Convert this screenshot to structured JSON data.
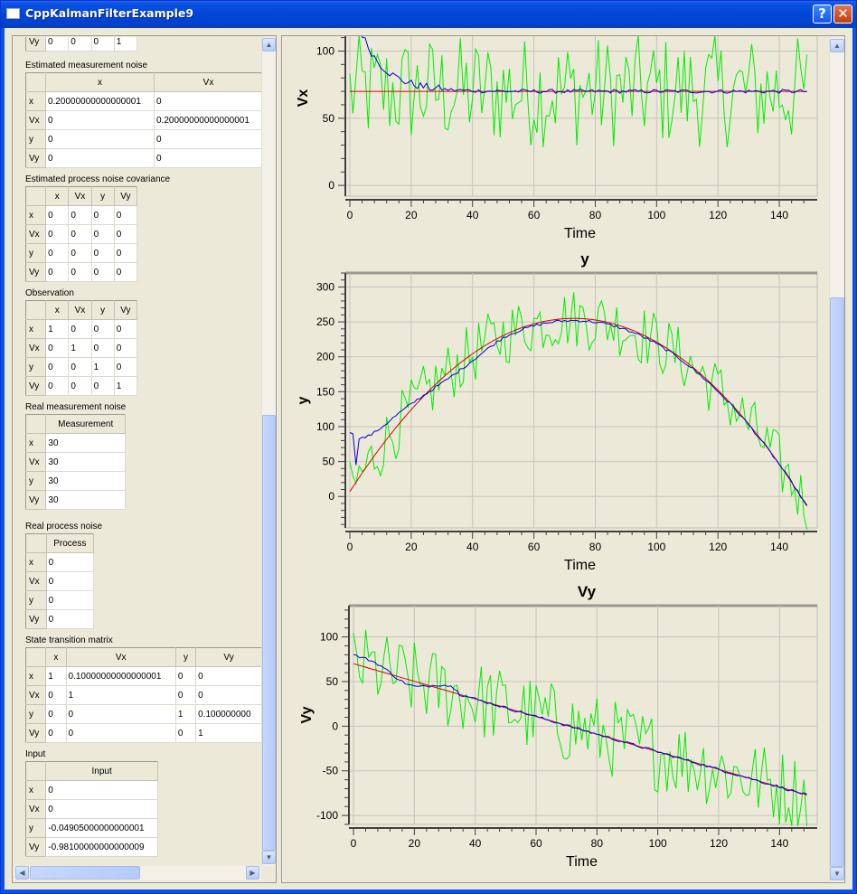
{
  "window": {
    "title": "CppKalmanFilterExample9",
    "help_label": "?",
    "close_label": "✕"
  },
  "left_panel": {
    "partial_row": {
      "header": "Vy",
      "cells": [
        "0",
        "0",
        "0",
        "1"
      ]
    },
    "estimated_measurement_noise": {
      "title": "Estimated measurement noise",
      "columns": [
        "x",
        "Vx"
      ],
      "rows": [
        {
          "header": "x",
          "cells": [
            "0.20000000000000001",
            "0"
          ]
        },
        {
          "header": "Vx",
          "cells": [
            "0",
            "0.20000000000000001"
          ]
        },
        {
          "header": "y",
          "cells": [
            "0",
            "0"
          ]
        },
        {
          "header": "Vy",
          "cells": [
            "0",
            "0"
          ]
        }
      ]
    },
    "estimated_process_noise": {
      "title": "Estimated process noise covariance",
      "columns": [
        "x",
        "Vx",
        "y",
        "Vy"
      ],
      "rows": [
        {
          "header": "x",
          "cells": [
            "0",
            "0",
            "0",
            "0"
          ]
        },
        {
          "header": "Vx",
          "cells": [
            "0",
            "0",
            "0",
            "0"
          ]
        },
        {
          "header": "y",
          "cells": [
            "0",
            "0",
            "0",
            "0"
          ]
        },
        {
          "header": "Vy",
          "cells": [
            "0",
            "0",
            "0",
            "0"
          ]
        }
      ]
    },
    "observation": {
      "title": "Observation",
      "columns": [
        "x",
        "Vx",
        "y",
        "Vy"
      ],
      "rows": [
        {
          "header": "x",
          "cells": [
            "1",
            "0",
            "0",
            "0"
          ]
        },
        {
          "header": "Vx",
          "cells": [
            "0",
            "1",
            "0",
            "0"
          ]
        },
        {
          "header": "y",
          "cells": [
            "0",
            "0",
            "1",
            "0"
          ]
        },
        {
          "header": "Vy",
          "cells": [
            "0",
            "0",
            "0",
            "1"
          ]
        }
      ]
    },
    "real_measurement_noise": {
      "title": "Real measurement noise",
      "columns": [
        "Measurement"
      ],
      "rows": [
        {
          "header": "x",
          "cells": [
            "30"
          ]
        },
        {
          "header": "Vx",
          "cells": [
            "30"
          ]
        },
        {
          "header": "y",
          "cells": [
            "30"
          ]
        },
        {
          "header": "Vy",
          "cells": [
            "30"
          ]
        }
      ]
    },
    "real_process_noise": {
      "title": "Real process noise",
      "columns": [
        "Process"
      ],
      "rows": [
        {
          "header": "x",
          "cells": [
            "0"
          ]
        },
        {
          "header": "Vx",
          "cells": [
            "0"
          ]
        },
        {
          "header": "y",
          "cells": [
            "0"
          ]
        },
        {
          "header": "Vy",
          "cells": [
            "0"
          ]
        }
      ]
    },
    "state_transition": {
      "title": "State transition matrix",
      "columns": [
        "x",
        "Vx",
        "y",
        "Vy"
      ],
      "rows": [
        {
          "header": "x",
          "cells": [
            "1",
            "0.10000000000000001",
            "0",
            "0"
          ]
        },
        {
          "header": "Vx",
          "cells": [
            "0",
            "1",
            "0",
            "0"
          ]
        },
        {
          "header": "y",
          "cells": [
            "0",
            "0",
            "1",
            "0.100000000"
          ]
        },
        {
          "header": "Vy",
          "cells": [
            "0",
            "0",
            "0",
            "1"
          ]
        }
      ]
    },
    "input": {
      "title": "Input",
      "columns": [
        "Input"
      ],
      "rows": [
        {
          "header": "x",
          "cells": [
            "0"
          ]
        },
        {
          "header": "Vx",
          "cells": [
            "0"
          ]
        },
        {
          "header": "y",
          "cells": [
            "-0.04905000000000001"
          ]
        },
        {
          "header": "Vy",
          "cells": [
            "-0.98100000000000009"
          ]
        }
      ]
    }
  },
  "colors": {
    "measured": "#00ee00",
    "estimated": "#0000dd",
    "real": "#dd0000",
    "plot_bg": "#ece9d8",
    "grid": "#c6c4bd"
  },
  "chart_data": [
    {
      "type": "line",
      "title": "",
      "xlabel": "Time",
      "ylabel": "Vx",
      "xlim": [
        0,
        150
      ],
      "ylim": [
        -8,
        138
      ],
      "xticks": [
        0,
        20,
        40,
        60,
        80,
        100,
        120,
        140
      ],
      "yticks": [
        0,
        50,
        100
      ],
      "series": [
        {
          "key": "real",
          "values_type": "constant",
          "value": 70
        },
        {
          "key": "estimated",
          "values_type": "decay",
          "start": 140,
          "end": 70,
          "tau": 8
        },
        {
          "key": "measured",
          "values_type": "noisy",
          "center": 70,
          "amplitude": 30
        }
      ]
    },
    {
      "type": "line",
      "title": "y",
      "xlabel": "Time",
      "ylabel": "y",
      "xlim": [
        0,
        150
      ],
      "ylim": [
        -45,
        320
      ],
      "xticks": [
        0,
        20,
        40,
        60,
        80,
        100,
        120,
        140
      ],
      "yticks": [
        0,
        50,
        100,
        150,
        200,
        250,
        300
      ],
      "series": [
        {
          "key": "real",
          "values_type": "parabola",
          "start": 7,
          "peak_x": 73,
          "peak_y": 255,
          "end": -35
        },
        {
          "key": "estimated",
          "values_type": "parabola_est",
          "start": 93,
          "peak_x": 73,
          "peak_y": 252,
          "end": -35
        },
        {
          "key": "measured",
          "values_type": "noisy_parabola",
          "amplitude": 30
        }
      ]
    },
    {
      "type": "line",
      "title": "Vy",
      "xlabel": "Time",
      "ylabel": "Vy",
      "xlim": [
        0,
        150
      ],
      "ylim": [
        -110,
        135
      ],
      "xticks": [
        0,
        20,
        40,
        60,
        80,
        100,
        120,
        140
      ],
      "yticks": [
        -100,
        -50,
        0,
        50,
        100
      ],
      "series": [
        {
          "key": "real",
          "values_type": "linear",
          "start": 70,
          "end": -77
        },
        {
          "key": "estimated",
          "values_type": "linear_est",
          "start": 80,
          "end": -77
        },
        {
          "key": "measured",
          "values_type": "noisy_linear",
          "amplitude": 30
        }
      ]
    }
  ]
}
